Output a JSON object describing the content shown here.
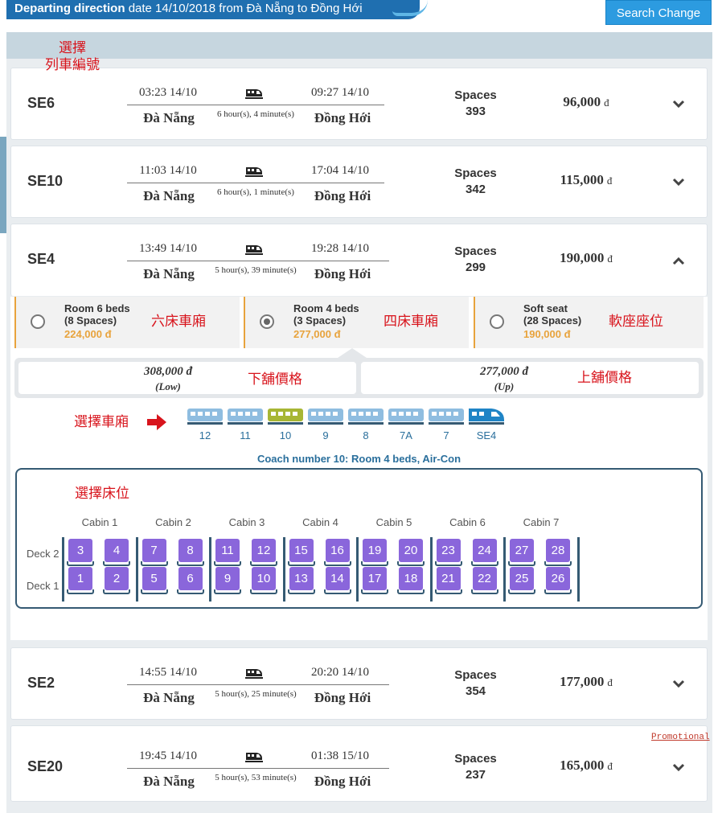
{
  "header": {
    "title_bold": "Departing direction",
    "title_rest": "date 14/10/2018 from Đà Nẵng to Đồng Hới",
    "search_change_label": "Search Change"
  },
  "annotations": {
    "select_train": "選擇\n列車編號",
    "room6": "六床車廂",
    "room4": "四床車廂",
    "softseat": "軟座座位",
    "lower_price": "下舖價格",
    "upper_price": "上舖價格",
    "select_coach": "選擇車廂",
    "select_berth": "選擇床位"
  },
  "trains": [
    {
      "code": "SE6",
      "dep": "03:23 14/10",
      "arr": "09:27 14/10",
      "from": "Đà Nẵng",
      "to": "Đồng Hới",
      "duration": "6 hour(s), 4 minute(s)",
      "spaces_label": "Spaces",
      "spaces": "393",
      "price": "96,000",
      "currency": "đ",
      "expanded": false
    },
    {
      "code": "SE10",
      "dep": "11:03 14/10",
      "arr": "17:04 14/10",
      "from": "Đà Nẵng",
      "to": "Đồng Hới",
      "duration": "6 hour(s), 1 minute(s)",
      "spaces_label": "Spaces",
      "spaces": "342",
      "price": "115,000",
      "currency": "đ",
      "expanded": false
    },
    {
      "code": "SE4",
      "dep": "13:49 14/10",
      "arr": "19:28 14/10",
      "from": "Đà Nẵng",
      "to": "Đồng Hới",
      "duration": "5 hour(s), 39 minute(s)",
      "spaces_label": "Spaces",
      "spaces": "299",
      "price": "190,000",
      "currency": "đ",
      "expanded": true
    },
    {
      "code": "SE2",
      "dep": "14:55 14/10",
      "arr": "20:20 14/10",
      "from": "Đà Nẵng",
      "to": "Đồng Hới",
      "duration": "5 hour(s), 25 minute(s)",
      "spaces_label": "Spaces",
      "spaces": "354",
      "price": "177,000",
      "currency": "đ",
      "expanded": false
    },
    {
      "code": "SE20",
      "dep": "19:45 14/10",
      "arr": "01:38 15/10",
      "from": "Đà Nẵng",
      "to": "Đồng Hới",
      "duration": "5 hour(s), 53 minute(s)",
      "spaces_label": "Spaces",
      "spaces": "237",
      "price": "165,000",
      "currency": "đ",
      "expanded": false,
      "promo": "Promotional"
    }
  ],
  "rooms": [
    {
      "name": "Room 6 beds",
      "spaces": "(8 Spaces)",
      "price": "224,000 đ",
      "selected": false
    },
    {
      "name": "Room 4 beds",
      "spaces": "(3 Spaces)",
      "price": "277,000 đ",
      "selected": true
    },
    {
      "name": "Soft seat",
      "spaces": "(28 Spaces)",
      "price": "190,000 đ",
      "selected": false
    }
  ],
  "berths": [
    {
      "price": "308,000 đ",
      "level": "(Low)"
    },
    {
      "price": "277,000 đ",
      "level": "(Up)"
    }
  ],
  "coaches": [
    {
      "label": "12",
      "color": "#8fbde0",
      "selected": false
    },
    {
      "label": "11",
      "color": "#8fbde0",
      "selected": false
    },
    {
      "label": "10",
      "color": "#a7b634",
      "selected": true
    },
    {
      "label": "9",
      "color": "#8fbde0",
      "selected": false
    },
    {
      "label": "8",
      "color": "#8fbde0",
      "selected": false
    },
    {
      "label": "7A",
      "color": "#8fbde0",
      "selected": false
    },
    {
      "label": "7",
      "color": "#8fbde0",
      "selected": false
    },
    {
      "label": "SE4",
      "color": "#1f84c6",
      "locomotive": true
    }
  ],
  "coach_info": "Coach number 10: Room 4 beds, Air-Con",
  "seatmap": {
    "deck_labels": [
      "Deck 2",
      "Deck 1"
    ],
    "cabins": [
      {
        "label": "Cabin 1",
        "upper": [
          "3",
          "4"
        ],
        "lower": [
          "1",
          "2"
        ]
      },
      {
        "label": "Cabin 2",
        "upper": [
          "7",
          "8"
        ],
        "lower": [
          "5",
          "6"
        ]
      },
      {
        "label": "Cabin 3",
        "upper": [
          "11",
          "12"
        ],
        "lower": [
          "9",
          "10"
        ]
      },
      {
        "label": "Cabin 4",
        "upper": [
          "15",
          "16"
        ],
        "lower": [
          "13",
          "14"
        ]
      },
      {
        "label": "Cabin 5",
        "upper": [
          "19",
          "20"
        ],
        "lower": [
          "17",
          "18"
        ]
      },
      {
        "label": "Cabin 6",
        "upper": [
          "23",
          "24"
        ],
        "lower": [
          "21",
          "22"
        ]
      },
      {
        "label": "Cabin 7",
        "upper": [
          "27",
          "28"
        ],
        "lower": [
          "25",
          "26"
        ]
      }
    ],
    "seat_color": "#8a66db"
  }
}
